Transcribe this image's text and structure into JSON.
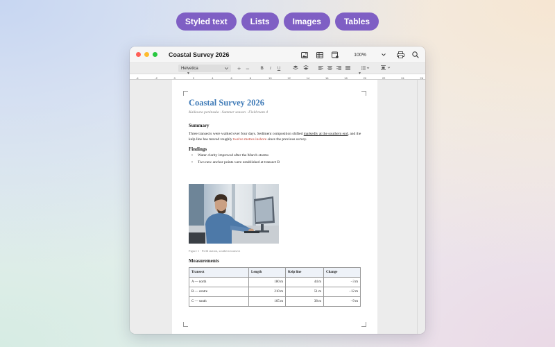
{
  "pills": [
    "Styled text",
    "Lists",
    "Images",
    "Tables"
  ],
  "window": {
    "title": "Coastal Survey 2026",
    "zoom": "100%",
    "colors": {
      "close": "#ff5f57",
      "minimize": "#febc2e",
      "zoom": "#28c840"
    }
  },
  "formatbar": {
    "font": "Helvetica",
    "plus": "+",
    "minus": "−",
    "bold": "B",
    "italic": "I",
    "underline": "U"
  },
  "ruler": [
    "-4",
    "-2",
    "0",
    "2",
    "4",
    "6",
    "8",
    "10",
    "12",
    "14",
    "16",
    "18",
    "20",
    "22",
    "24",
    "26"
  ],
  "doc": {
    "title": "Coastal Survey 2026",
    "subtitle": "Kaikoura peninsula · Summer season · Field team 4",
    "summary_heading": "Summary",
    "summary": {
      "p1": "Three transects were walked over four days. Sediment composition shifted ",
      "u1": "markedly at the southern end",
      "p2": ", and the kelp line has moved roughly ",
      "red": "twelve metres inshore",
      "p3": " since the previous survey."
    },
    "findings_heading": "Findings",
    "findings": [
      "Water clarity improved after the March storms",
      "Two new anchor points were established at transect B"
    ],
    "figure_caption": "Figure 1 · Field station, southern transect",
    "measurements_heading": "Measurements",
    "table": {
      "headers": [
        "Transect",
        "Length",
        "Kelp line",
        "Change"
      ],
      "rows": [
        [
          "A — north",
          "180 m",
          "44 m",
          "−3 m"
        ],
        [
          "B — centre",
          "210 m",
          "51 m",
          "−12 m"
        ],
        [
          "C — south",
          "165 m",
          "38 m",
          "−9 m"
        ]
      ]
    }
  }
}
